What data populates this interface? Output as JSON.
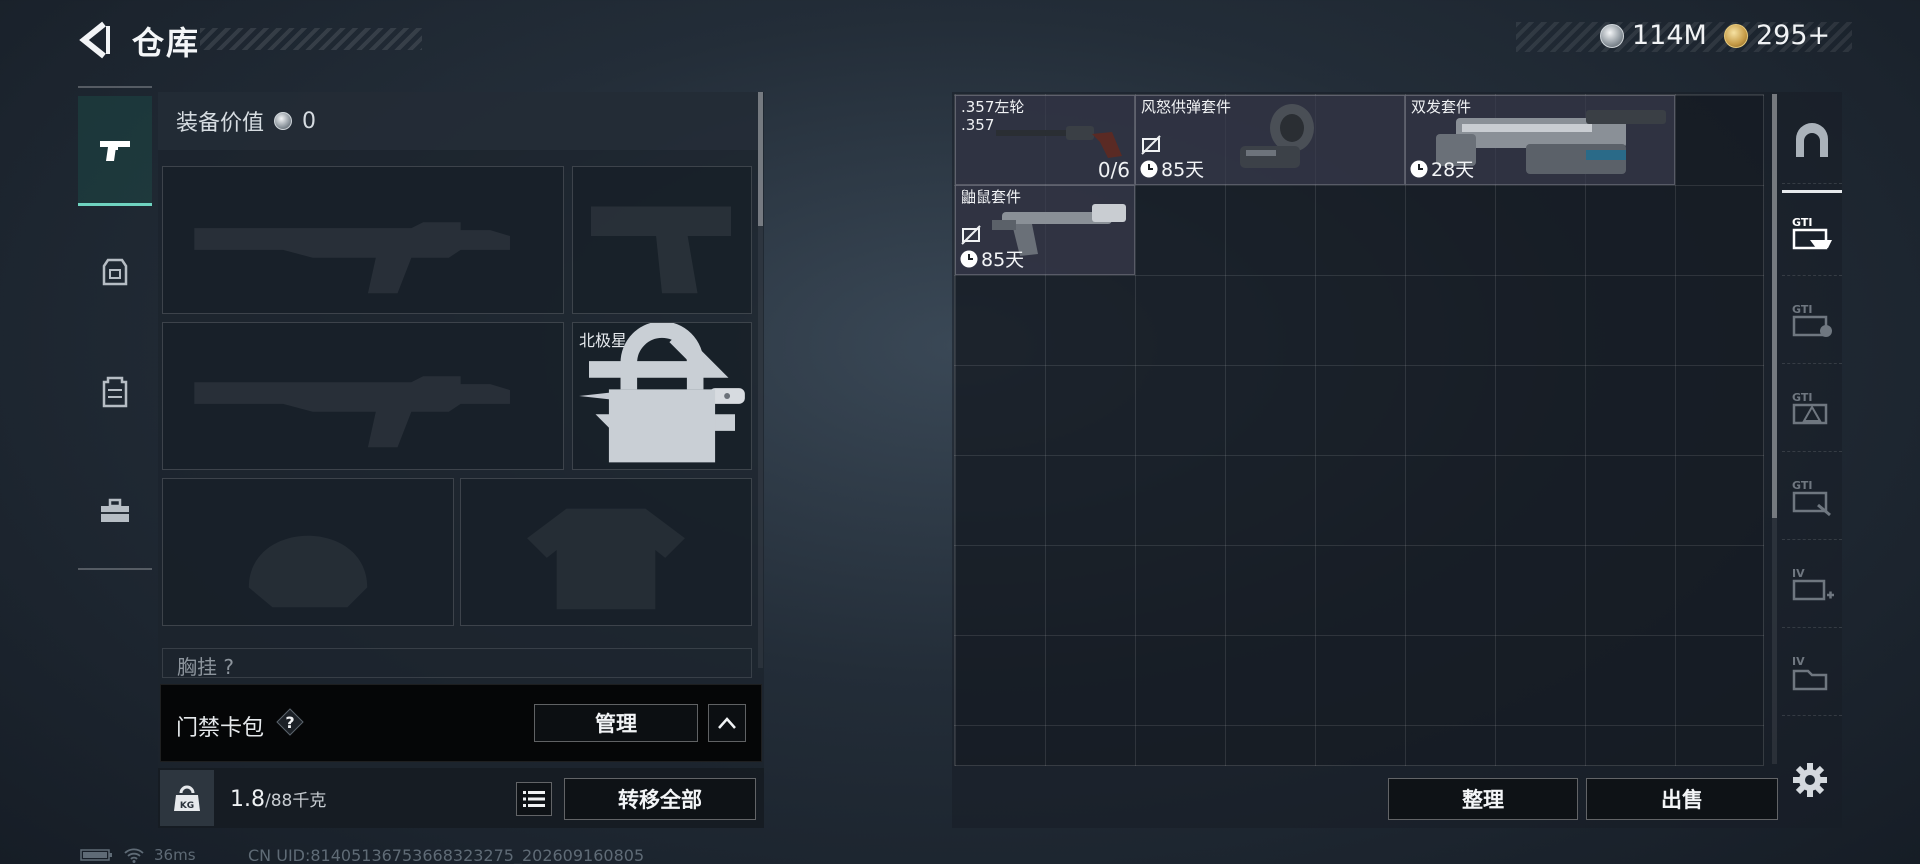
{
  "header": {
    "title": "仓库",
    "currencies": [
      {
        "icon": "silver-coin-icon",
        "amount": "114M"
      },
      {
        "icon": "gold-coin-icon",
        "amount": "295+"
      }
    ]
  },
  "left_rail": {
    "items": [
      {
        "name": "weapons",
        "icon": "pistol-icon",
        "active": true
      },
      {
        "name": "backpack",
        "icon": "backpack-icon",
        "active": false
      },
      {
        "name": "vest",
        "icon": "vest-icon",
        "active": false
      },
      {
        "name": "toolbox",
        "icon": "toolbox-icon",
        "active": false
      }
    ]
  },
  "equipment": {
    "value_label": "装备价值",
    "value": "0",
    "melee": {
      "name": "北极星",
      "locked": true
    },
    "chest_label": "胸挂 ?"
  },
  "cardpack": {
    "label": "门禁卡包",
    "help": "?",
    "manage": "管理"
  },
  "inventory": {
    "weight": "1.8",
    "capacity": "/88千克",
    "kg_label": "KG",
    "transfer_all": "转移全部"
  },
  "status": {
    "ping": "36ms",
    "uid": "CN UID:814051367536683232​75_202609160805"
  },
  "stash": {
    "items": [
      {
        "name": ".357左轮",
        "sub": ".357",
        "count": "0/6",
        "timer": null
      },
      {
        "name": "风怒供弹套件",
        "sub": "",
        "count": null,
        "timer": "85天",
        "no_trade": true
      },
      {
        "name": "双发套件",
        "sub": "",
        "count": null,
        "timer": "28天"
      },
      {
        "name": "鼬鼠套件",
        "sub": "",
        "count": null,
        "timer": "85天",
        "no_trade": true
      }
    ],
    "sort": "整理",
    "sell": "出售"
  },
  "right_rail": {
    "items": [
      {
        "label": "",
        "icon": "stash-arch-icon"
      },
      {
        "label": "GTI",
        "icon": "gti-weapon-case-icon"
      },
      {
        "label": "GTI",
        "icon": "gti-ammo-case-icon"
      },
      {
        "label": "GTI",
        "icon": "gti-hazard-case-icon"
      },
      {
        "label": "GTI",
        "icon": "gti-key-case-icon"
      },
      {
        "label": "IV",
        "icon": "iv-medical-case-icon"
      },
      {
        "label": "IV",
        "icon": "iv-storage-case-icon"
      }
    ]
  }
}
